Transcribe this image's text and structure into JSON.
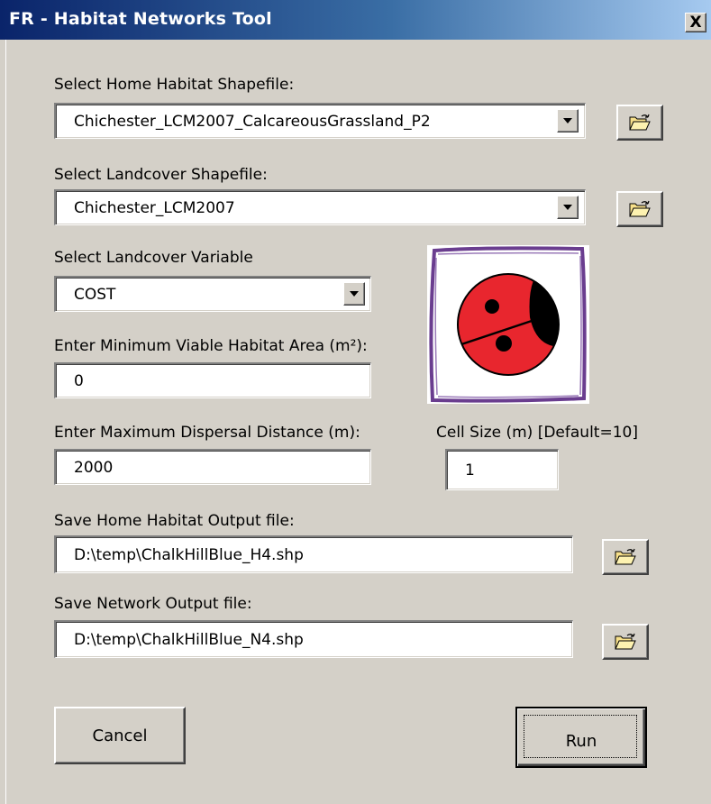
{
  "window": {
    "title": "FR - Habitat Networks Tool",
    "close_label": "X"
  },
  "home_habitat": {
    "label": "Select Home Habitat Shapefile:",
    "value": "Chichester_LCM2007_CalcareousGrassland_P2",
    "browse_icon": "open-folder-icon"
  },
  "landcover": {
    "label": "Select Landcover Shapefile:",
    "value": "Chichester_LCM2007",
    "browse_icon": "open-folder-icon"
  },
  "landcover_variable": {
    "label": "Select Landcover Variable",
    "value": "COST"
  },
  "min_area": {
    "label": "Enter Minimum Viable Habitat Area (m²):",
    "value": "0"
  },
  "max_dispersal": {
    "label": "Enter Maximum Dispersal Distance (m):",
    "value": "2000"
  },
  "cell_size": {
    "label": "Cell Size (m) [Default=10]",
    "value": "1"
  },
  "home_output": {
    "label": "Save Home Habitat Output file:",
    "value": "D:\\temp\\ChalkHillBlue_H4.shp",
    "browse_icon": "open-folder-icon"
  },
  "network_output": {
    "label": "Save Network Output file:",
    "value": "D:\\temp\\ChalkHillBlue_N4.shp",
    "browse_icon": "open-folder-icon"
  },
  "buttons": {
    "cancel": "Cancel",
    "run": "Run"
  },
  "logo": {
    "icon": "ladybird-icon",
    "colors": {
      "body": "#e8262e",
      "head": "#000000",
      "frame": "#6a3d8f"
    }
  }
}
